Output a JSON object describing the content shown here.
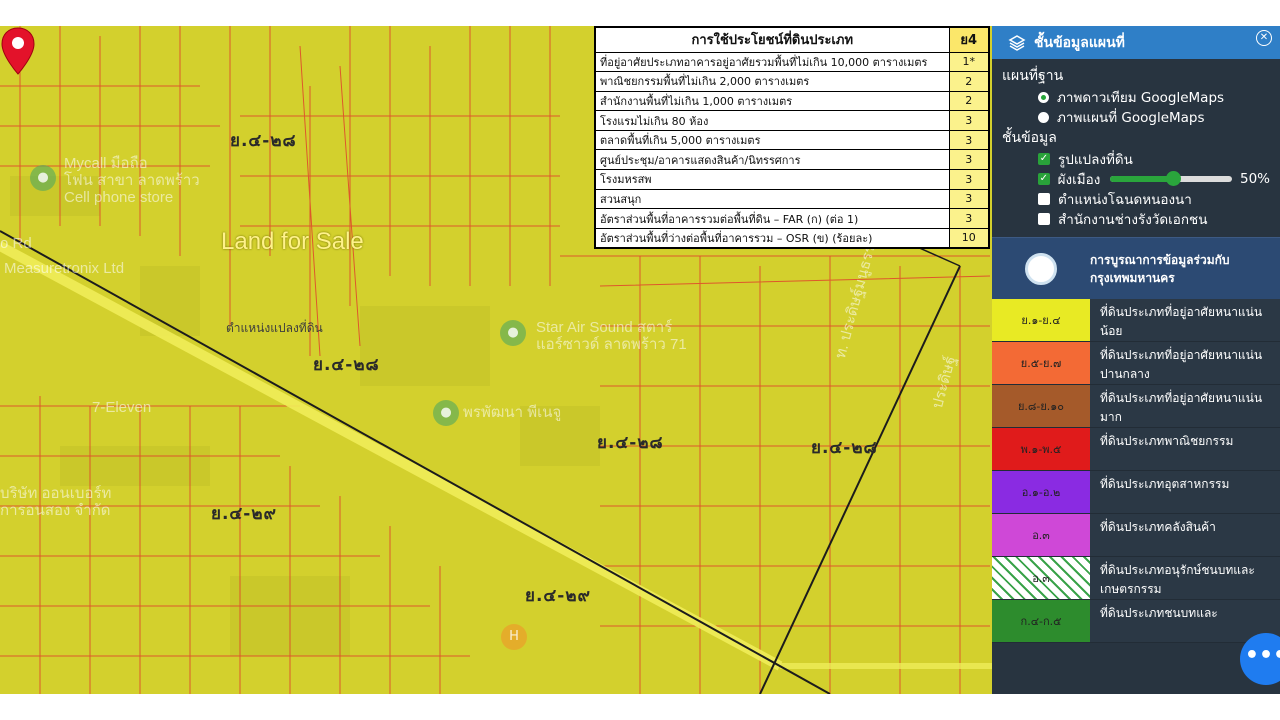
{
  "map": {
    "title": "Land for Sale",
    "marker_caption": "ตำแหน่งแปลงที่ดิน",
    "zone_labels": [
      "ย.๔-๒๘",
      "ย.๔-๒๘",
      "ย.๔-๒๘",
      "ย.๔-๒๘",
      "ย.๔-๒๙",
      "ย.๔-๒๙"
    ],
    "poi": {
      "mycall": "Mycall มือถือ\nโฟน สาขา ลาดพร้าว\nCell phone store",
      "measuretronix": "Measuretronix Ltd",
      "star_air": "Star Air Sound สตาร์\nแอร์ซาวด์ ลาดพร้าว 71",
      "seven_eleven": "7-Eleven",
      "pruksa": "พรพัฒนา พีเนจู",
      "company": "บริษัท ออนเบอร์ท\nการอนสอง จำกัด",
      "road_left": "o Rd",
      "road_sathan": "ท. ประดิษฐ์มนูธรรม",
      "road_talat": "ประดิษฐ์"
    }
  },
  "landuse": {
    "header": "การใช้ประโยชน์ที่ดินประเภท",
    "header_code": "ย4",
    "rows": [
      {
        "label": "ที่อยู่อาศัยประเภทอาคารอยู่อาศัยรวมพื้นที่ไม่เกิน 10,000 ตารางเมตร",
        "value": "1*"
      },
      {
        "label": "พาณิชยกรรมพื้นที่ไม่เกิน 2,000 ตารางเมตร",
        "value": "2"
      },
      {
        "label": "สำนักงานพื้นที่ไม่เกิน 1,000 ตารางเมตร",
        "value": "2"
      },
      {
        "label": "โรงแรมไม่เกิน 80 ห้อง",
        "value": "3"
      },
      {
        "label": "ตลาดพื้นที่เกิน 5,000 ตารางเมตร",
        "value": "3"
      },
      {
        "label": "ศูนย์ประชุม/อาคารแสดงสินค้า/นิทรรศการ",
        "value": "3"
      },
      {
        "label": "โรงมหรสพ",
        "value": "3"
      },
      {
        "label": "สวนสนุก",
        "value": "3"
      },
      {
        "label": "อัตราส่วนพื้นที่อาคารรวมต่อพื้นที่ดิน – FAR (ก) (ต่อ 1)",
        "value": "3"
      },
      {
        "label": "อัตราส่วนพื้นที่ว่างต่อพื้นที่อาคารรวม – OSR (ข) (ร้อยละ)",
        "value": "10"
      }
    ]
  },
  "panel": {
    "title": "ชั้นข้อมูลแผนที่",
    "basemap_title": "แผนที่ฐาน",
    "basemap_options": [
      "ภาพดาวเทียม GoogleMaps",
      "ภาพแผนที่ GoogleMaps"
    ],
    "basemap_selected": 0,
    "layers_title": "ชั้นข้อมูล",
    "layers": [
      {
        "label": "รูปแปลงที่ดิน",
        "checked": true
      },
      {
        "label": "ผังเมือง",
        "checked": true
      },
      {
        "label": "ตำแหน่งโฉนดหนองนา",
        "checked": false
      },
      {
        "label": "สำนักงานช่างรังวัดเอกชน",
        "checked": false
      }
    ],
    "opacity_value": 50,
    "opacity_label": "50%",
    "bma_text": "การบูรณาการข้อมูลร่วมกับ\nกรุงเทพมหานคร",
    "legend": [
      {
        "code": "ย.๑-ย.๔",
        "label": "ที่ดินประเภทที่อยู่อาศัยหนาแน่น\nน้อย",
        "color": "#e8ea24"
      },
      {
        "code": "ย.๕-ย.๗",
        "label": "ที่ดินประเภทที่อยู่อาศัยหนาแน่น\nปานกลาง",
        "color": "#f36a35"
      },
      {
        "code": "ย.๘-ย.๑๐",
        "label": "ที่ดินประเภทที่อยู่อาศัยหนาแน่น\nมาก",
        "color": "#a55a2a"
      },
      {
        "code": "พ.๑-พ.๕",
        "label": "ที่ดินประเภทพาณิชยกรรม",
        "color": "#e01b1b"
      },
      {
        "code": "อ.๑-อ.๒",
        "label": "ที่ดินประเภทอุตสาหกรรม",
        "color": "#8a2be2"
      },
      {
        "code": "อ.๓",
        "label": "ที่ดินประเภทคลังสินค้า",
        "color": "#cf48d7"
      },
      {
        "code": "อ.๓",
        "label": "ที่ดินประเภทอนุรักษ์ชนบทและ\nเกษตรกรรม",
        "color": "#eef6ea"
      },
      {
        "code": "ก.๔-ก.๕",
        "label": "ที่ดินประเภทชนบทและ",
        "color": "#2d8c2d"
      }
    ]
  },
  "fab_label": "•••"
}
